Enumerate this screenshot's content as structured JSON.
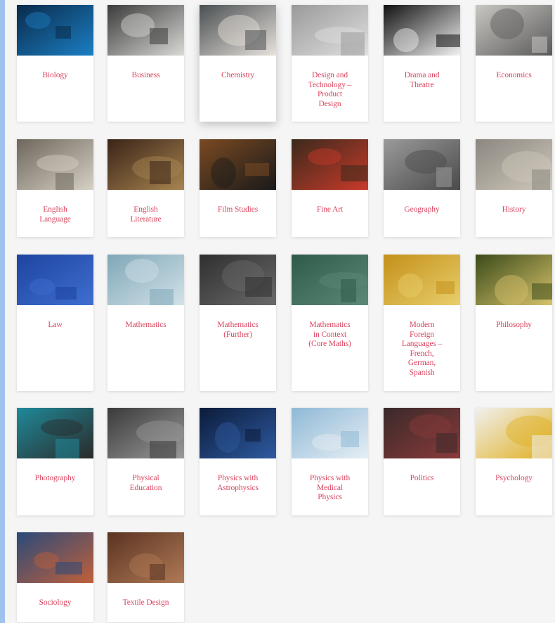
{
  "accent_color": "#d9455f",
  "subjects": [
    {
      "label": "Biology",
      "icon": "dna-helix-image",
      "colors": [
        "#0a2a4a",
        "#1b7fc4"
      ]
    },
    {
      "label": "Business",
      "icon": "laptop-meeting-image",
      "colors": [
        "#3b3b3b",
        "#d9d9d6"
      ]
    },
    {
      "label": "Chemistry",
      "icon": "scientist-pipette-image",
      "colors": [
        "#4a4f52",
        "#e8e2dc"
      ]
    },
    {
      "label": "Design and\nTechnology –\nProduct\nDesign",
      "icon": "technical-drawing-image",
      "colors": [
        "#9a9a9a",
        "#e0e0e0"
      ]
    },
    {
      "label": "Drama and\nTheatre",
      "icon": "theatre-masks-image",
      "colors": [
        "#111111",
        "#f2f2f2"
      ]
    },
    {
      "label": "Economics",
      "icon": "calculator-image",
      "colors": [
        "#c9c7c2",
        "#5a5a5a"
      ]
    },
    {
      "label": "English\nLanguage",
      "icon": "dictionary-page-image",
      "colors": [
        "#6e665a",
        "#d6d1c5"
      ]
    },
    {
      "label": "English\nLiterature",
      "icon": "old-books-image",
      "colors": [
        "#3a2418",
        "#a8844f"
      ]
    },
    {
      "label": "Film Studies",
      "icon": "clapperboard-image",
      "colors": [
        "#7a4a22",
        "#1a1a1a"
      ]
    },
    {
      "label": "Fine Art",
      "icon": "paint-supplies-image",
      "colors": [
        "#3a2a1c",
        "#c93a2a"
      ]
    },
    {
      "label": "Geography",
      "icon": "world-map-image",
      "colors": [
        "#9a9a9a",
        "#4a4a4a"
      ]
    },
    {
      "label": "History",
      "icon": "ancient-wall-image",
      "colors": [
        "#8b8780",
        "#cfc8bb"
      ]
    },
    {
      "label": "Law",
      "icon": "lady-justice-image",
      "colors": [
        "#1e44a0",
        "#3f6fd0"
      ]
    },
    {
      "label": "Mathematics",
      "icon": "numbers-pile-image",
      "colors": [
        "#7fa7b8",
        "#d3e2e8"
      ]
    },
    {
      "label": "Mathematics\n(Further)",
      "icon": "chalkboard-equations-image",
      "colors": [
        "#2f2f2f",
        "#6a6a6a"
      ]
    },
    {
      "label": "Mathematics\nin Context\n(Core Maths)",
      "icon": "green-chalkboard-image",
      "colors": [
        "#2f5a4a",
        "#5c8a77"
      ]
    },
    {
      "label": "Modern\nForeign\nLanguages –\nFrench,\nGerman,\nSpanish",
      "icon": "globe-map-image",
      "colors": [
        "#c4901a",
        "#e8cf6b"
      ]
    },
    {
      "label": "Philosophy",
      "icon": "reading-book-image",
      "colors": [
        "#3a4a1a",
        "#d6c26a"
      ]
    },
    {
      "label": "Photography",
      "icon": "camera-lens-image",
      "colors": [
        "#1f8a9a",
        "#2a2a2a"
      ]
    },
    {
      "label": "Physical\nEducation",
      "icon": "runners-race-image",
      "colors": [
        "#3a3a3a",
        "#9a9a9a"
      ]
    },
    {
      "label": "Physics with\nAstrophysics",
      "icon": "observatory-image",
      "colors": [
        "#0c1b3a",
        "#2e5aa0"
      ]
    },
    {
      "label": "Physics with\nMedical\nPhysics",
      "icon": "mri-scanner-image",
      "colors": [
        "#8fb9d6",
        "#e6eef4"
      ]
    },
    {
      "label": "Politics",
      "icon": "protest-sign-image",
      "colors": [
        "#3a2a2a",
        "#8a3a3a"
      ]
    },
    {
      "label": "Psychology",
      "icon": "head-silhouette-image",
      "colors": [
        "#f0f0f0",
        "#e0b020"
      ]
    },
    {
      "label": "Sociology",
      "icon": "magnifier-faces-image",
      "colors": [
        "#2a4a7a",
        "#c0603a"
      ]
    },
    {
      "label": "Textile Design",
      "icon": "dress-mannequin-image",
      "colors": [
        "#5a3322",
        "#b07a55"
      ]
    }
  ]
}
